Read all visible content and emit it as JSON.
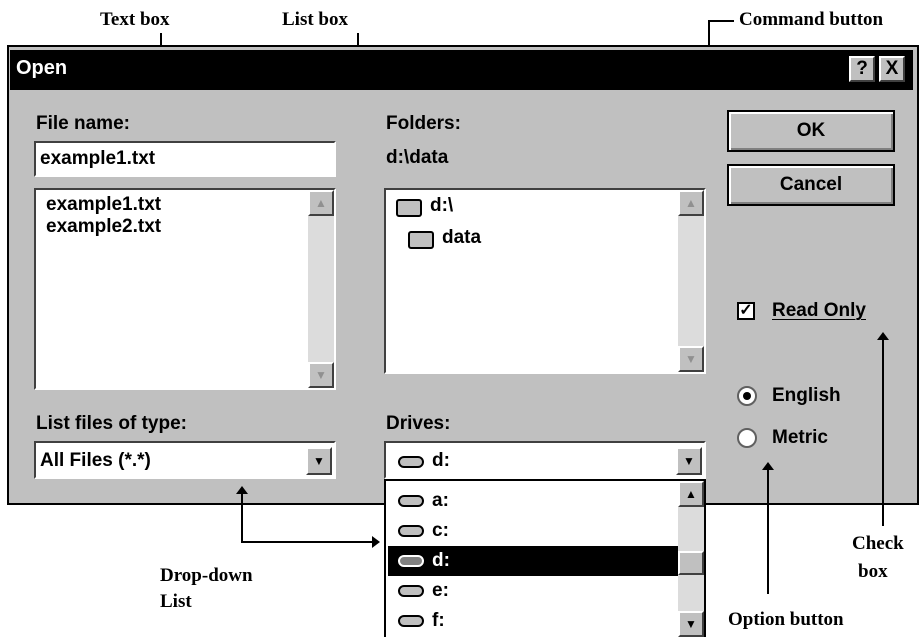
{
  "annotations": {
    "text_box": "Text box",
    "list_box": "List box",
    "command_button": "Command button",
    "check_box_line1": "Check",
    "check_box_line2": "box",
    "option_button": "Option button",
    "drop_down_line1": "Drop-down",
    "drop_down_line2": "List"
  },
  "dialog": {
    "title": "Open",
    "help_button": "?",
    "close_button": "X"
  },
  "file_name": {
    "label": "File name:",
    "value": "example1.txt",
    "files": [
      "example1.txt",
      "example2.txt"
    ]
  },
  "folders": {
    "label": "Folders:",
    "current_path": "d:\\data",
    "items": [
      "d:\\",
      "data"
    ]
  },
  "buttons": {
    "ok": "OK",
    "cancel": "Cancel"
  },
  "read_only": {
    "label": "Read Only",
    "checked": true,
    "check_glyph": "✓"
  },
  "units": {
    "options": [
      "English",
      "Metric"
    ],
    "selected": "English"
  },
  "list_files_of_type": {
    "label": "List files of type:",
    "value": "All Files (*.*)"
  },
  "drives": {
    "label": "Drives:",
    "value": "d:",
    "options": [
      "a:",
      "c:",
      "d:",
      "e:",
      "f:"
    ],
    "highlighted": "d:"
  },
  "glyphs": {
    "scroll_up": "▲",
    "scroll_down": "▼"
  }
}
